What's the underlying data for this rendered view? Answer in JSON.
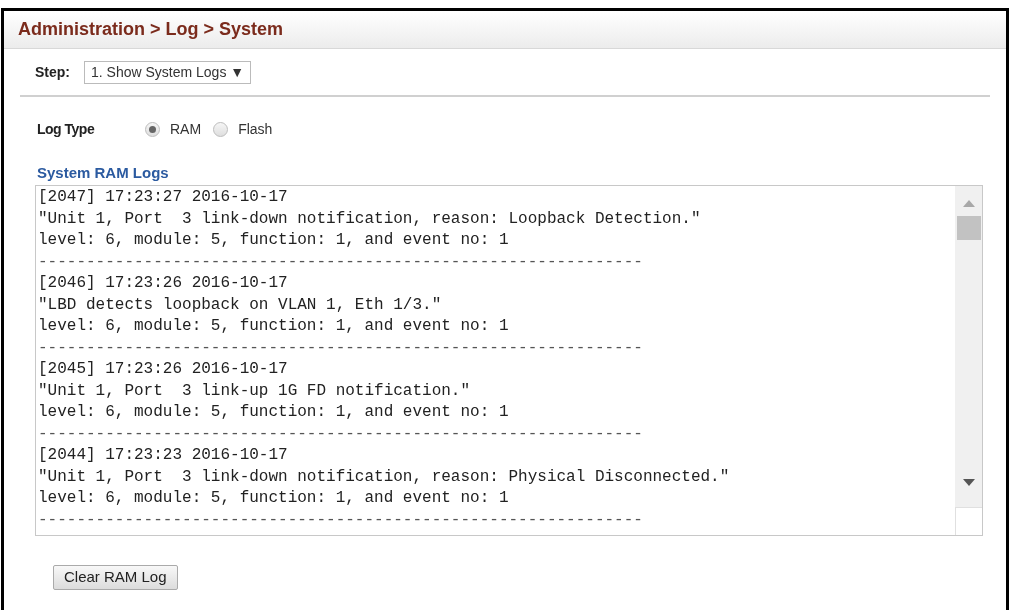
{
  "breadcrumb": "Administration > Log > System",
  "step": {
    "label": "Step:",
    "value": "1. Show System Logs ▼"
  },
  "log_type": {
    "label": "Log Type",
    "options": [
      {
        "label": "RAM",
        "selected": true
      },
      {
        "label": "Flash",
        "selected": false
      }
    ]
  },
  "section_title": "System RAM Logs",
  "log_entries": [
    {
      "header": "[2047] 17:23:27 2016-10-17",
      "message": "\"Unit 1, Port  3 link-down notification, reason: Loopback Detection.\"",
      "details": "level: 6, module: 5, function: 1, and event no: 1",
      "separator": "---------------------------------------------------------------"
    },
    {
      "header": "[2046] 17:23:26 2016-10-17",
      "message": "\"LBD detects loopback on VLAN 1, Eth 1/3.\"",
      "details": "level: 6, module: 5, function: 1, and event no: 1",
      "separator": "---------------------------------------------------------------"
    },
    {
      "header": "[2045] 17:23:26 2016-10-17",
      "message": "\"Unit 1, Port  3 link-up 1G FD notification.\"",
      "details": "level: 6, module: 5, function: 1, and event no: 1",
      "separator": "---------------------------------------------------------------"
    },
    {
      "header": "[2044] 17:23:23 2016-10-17",
      "message": "\"Unit 1, Port  3 link-down notification, reason: Physical Disconnected.\"",
      "details": "level: 6, module: 5, function: 1, and event no: 1",
      "separator": "---------------------------------------------------------------"
    }
  ],
  "clear_button": "Clear RAM Log"
}
